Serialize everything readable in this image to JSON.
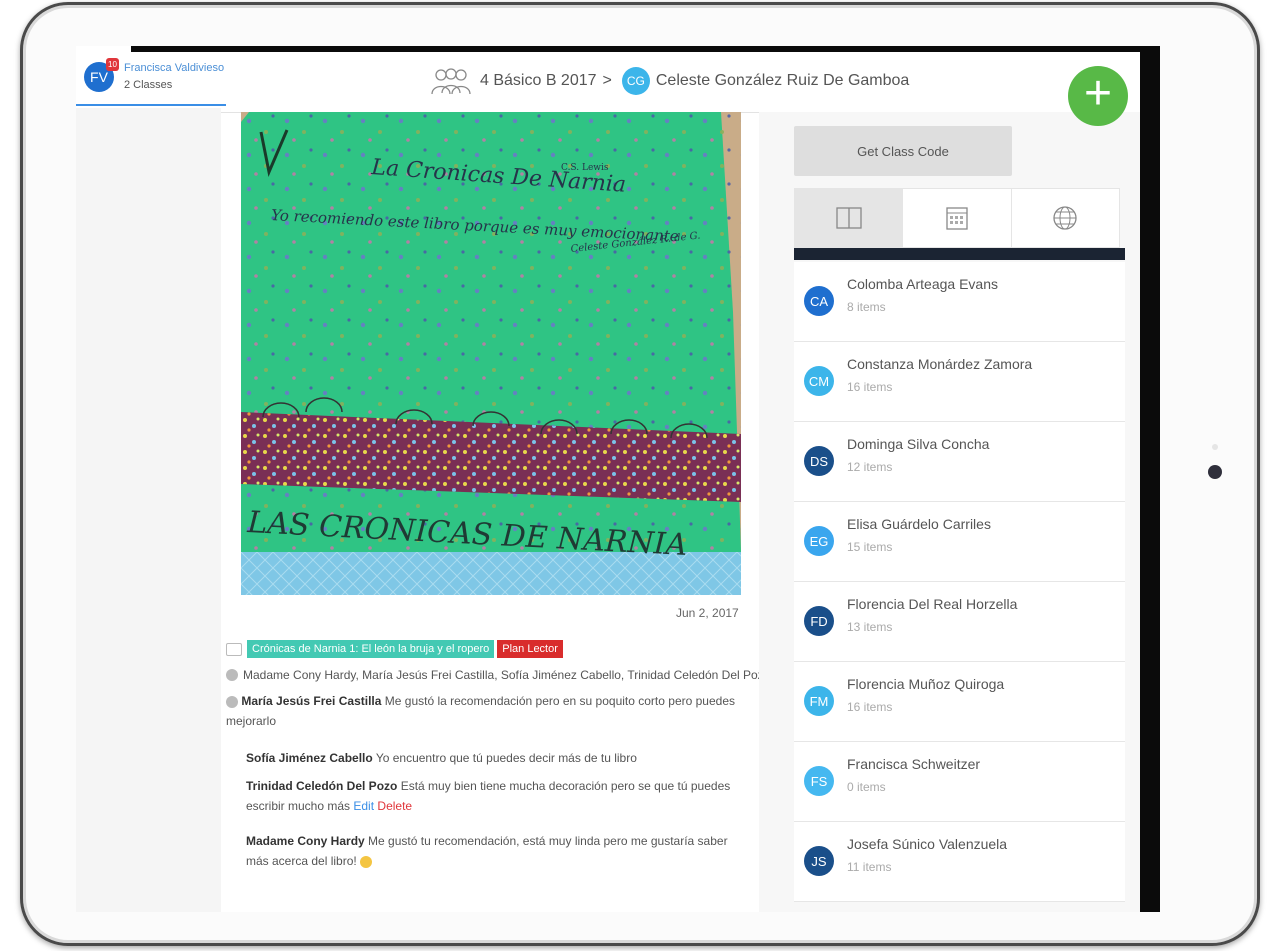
{
  "user": {
    "initials": "FV",
    "name": "Francisca Valdivieso",
    "classes": "2 Classes",
    "notification_count": "10"
  },
  "breadcrumb": {
    "class_name": "4 Básico B 2017",
    "separator": ">",
    "student_initials": "CG",
    "student_name": "Celeste González Ruiz De Gamboa"
  },
  "fab": {
    "label": "+"
  },
  "post": {
    "date": "Jun 2, 2017",
    "tags": [
      "Crónicas de Narnia 1: El león la bruja y el ropero",
      "Plan Lector"
    ],
    "likes": "Madame Cony Hardy, María Jesús Frei Castilla, Sofía Jiménez Cabello, Trinidad Celedón Del Pozo",
    "comments": [
      {
        "author": "María Jesús Frei Castilla",
        "text": "Me gustó la recomendación pero en su poquito corto pero puedes mejorarlo"
      },
      {
        "author": "Sofía Jiménez Cabello",
        "text": "Yo encuentro que tú puedes decir más de tu libro"
      },
      {
        "author": "Trinidad Celedón Del Pozo",
        "text": "Está muy bien tiene mucha decoración pero se que tú puedes escribir mucho más",
        "edit": "Edit",
        "delete": "Delete"
      },
      {
        "author": "Madame Cony Hardy",
        "text": "Me gustó tu recomendación, está muy linda pero me gustaría saber más acerca del libro!"
      }
    ]
  },
  "sidebar": {
    "class_code_label": "Get Class Code",
    "tabs": [
      "book-icon",
      "calendar-icon",
      "globe-icon"
    ],
    "students": [
      {
        "initials": "CA",
        "name": "Colomba Arteaga Evans",
        "items": "8 items",
        "color": "#1f6fcf"
      },
      {
        "initials": "CM",
        "name": "Constanza Monárdez Zamora",
        "items": "16 items",
        "color": "#3cb5ea"
      },
      {
        "initials": "DS",
        "name": "Dominga Silva Concha",
        "items": "12 items",
        "color": "#1a4f8a"
      },
      {
        "initials": "EG",
        "name": "Elisa Guárdelo Carriles",
        "items": "15 items",
        "color": "#3aa6ee"
      },
      {
        "initials": "FD",
        "name": "Florencia Del Real Horzella",
        "items": "13 items",
        "color": "#1a4f8a"
      },
      {
        "initials": "FM",
        "name": "Florencia Muñoz Quiroga",
        "items": "16 items",
        "color": "#3cb5ea"
      },
      {
        "initials": "FS",
        "name": "Francisca Schweitzer",
        "items": "0 items",
        "color": "#45b8f0"
      },
      {
        "initials": "JS",
        "name": "Josefa Súnico Valenzuela",
        "items": "11 items",
        "color": "#1a4f8a"
      }
    ]
  },
  "photo": {
    "top_title": "La Cronicas De Narnia",
    "top_author": "C.S. Lewis",
    "top_line": "Yo recomiendo este libro porque es muy emocionante",
    "signature": "Celeste González R. de G.",
    "bottom_title": "LAS CRONICAS DE NARNIA"
  }
}
